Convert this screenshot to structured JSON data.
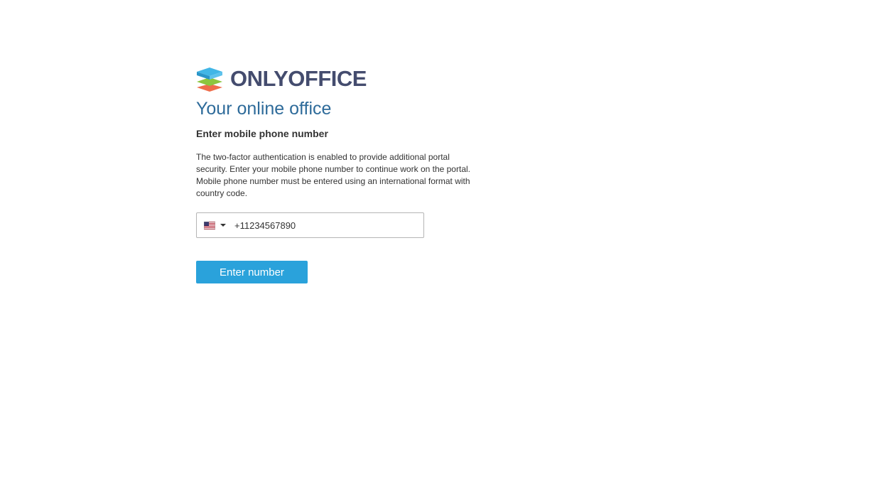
{
  "brand": {
    "name": "ONLYOFFICE",
    "tagline": "Your online office",
    "icon": "onlyoffice-logo-icon",
    "colors": {
      "text": "#444c6e",
      "tagline": "#2e6b9a",
      "layer_top": "#41b6e6",
      "layer_middle": "#8cc63f",
      "layer_bottom": "#ef6c4b"
    }
  },
  "form": {
    "heading": "Enter mobile phone number",
    "description": "The two-factor authentication is enabled to provide additional portal security. Enter your mobile phone number to continue work on the portal. Mobile phone number must be entered using an international format with country code.",
    "country_flag_icon": "us-flag-icon",
    "phone_value": "+11234567890",
    "submit_label": "Enter number",
    "submit_color": "#2aa2db"
  }
}
